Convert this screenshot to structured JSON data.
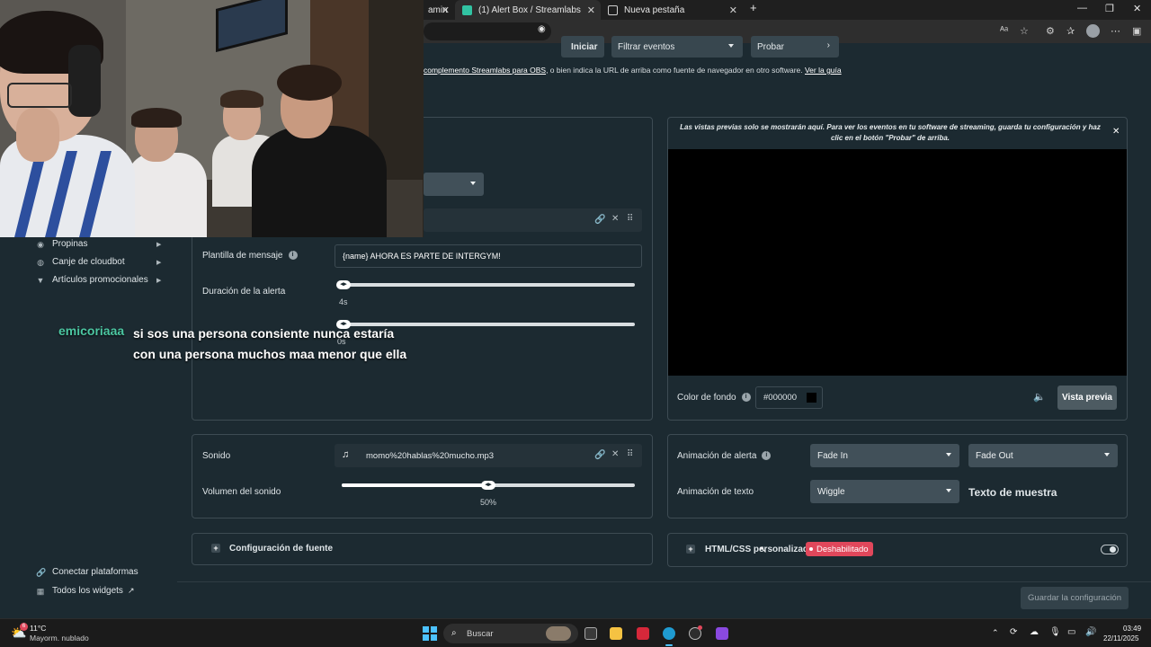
{
  "browser": {
    "tabs": [
      {
        "label": "amin",
        "close": "✕"
      },
      {
        "label": "(1) Alert Box / Streamlabs",
        "close": "✕"
      },
      {
        "label": "Nueva pestaña",
        "close": "✕"
      }
    ],
    "new_tab": "+",
    "window_controls": [
      "—",
      "❐",
      "✕"
    ]
  },
  "toolbar": {
    "launch_label": "Iniciar",
    "filter_label": "Filtrar eventos",
    "test_label": "Probar",
    "hint_text": " complemento Streamlabs para OBS",
    "hint_mid": ", o bien indica la URL de arriba como fuente de navegador en otro software. ",
    "hint_link": "Ver la guía"
  },
  "sidebar": {
    "items": [
      {
        "label": "Propinas",
        "icon": "coins-icon"
      },
      {
        "label": "Canje de cloudbot",
        "icon": "cloudbot-icon"
      },
      {
        "label": "Artículos promocionales",
        "icon": "shirt-icon"
      }
    ],
    "bottom": [
      {
        "label": "Conectar plataformas",
        "icon": "link-icon"
      },
      {
        "label": "Todos los widgets",
        "icon": "grid-icon"
      }
    ]
  },
  "alert_settings": {
    "template_label": "Plantilla de mensaje",
    "template_value": "{name} AHORA ES PARTE DE INTERGYM!",
    "duration_label": "Duración de la alerta",
    "duration_value": "4s",
    "delay_value": "0s",
    "sound_label": "Sonido",
    "sound_file": "momo%20hablas%20mucho.mp3",
    "volume_label": "Volumen del sonido",
    "volume_value": "50%",
    "volume_fraction": 0.5,
    "font_config_label": "Configuración de fuente"
  },
  "preview": {
    "notice": "Las vistas previas solo se mostrarán aquí. Para ver los eventos en tu software de streaming, guarda tu configuración y haz clic en el botón \"Probar\" de arriba.",
    "bg_label": "Color de fondo",
    "bg_value": "#000000",
    "preview_button": "Vista previa",
    "canvas_color": "#000000"
  },
  "animation": {
    "alert_label": "Animación de alerta",
    "alert_in": "Fade In",
    "alert_out": "Fade Out",
    "text_label": "Animación de texto",
    "text_value": "Wiggle",
    "sample_text": "Texto de muestra"
  },
  "custom_css": {
    "label": "HTML/CSS personalizado",
    "status": "Deshabilitado",
    "enabled": false
  },
  "save_button": "Guardar la configuración",
  "chat": {
    "username": "emicoriaaa",
    "message_line1": "si sos una persona consiente nunca estaría",
    "message_line2": "con una persona muchos maa menor que ella"
  },
  "taskbar": {
    "weather_temp": "11°C",
    "weather_desc": "Mayorm. nublado",
    "search_placeholder": "Buscar",
    "time": "03:49",
    "date": "22/11/2025",
    "notif_count": "6"
  },
  "colors": {
    "page_bg": "#1c2a31",
    "accent_green": "#4cc7a2",
    "disabled_badge": "#e0475b"
  }
}
